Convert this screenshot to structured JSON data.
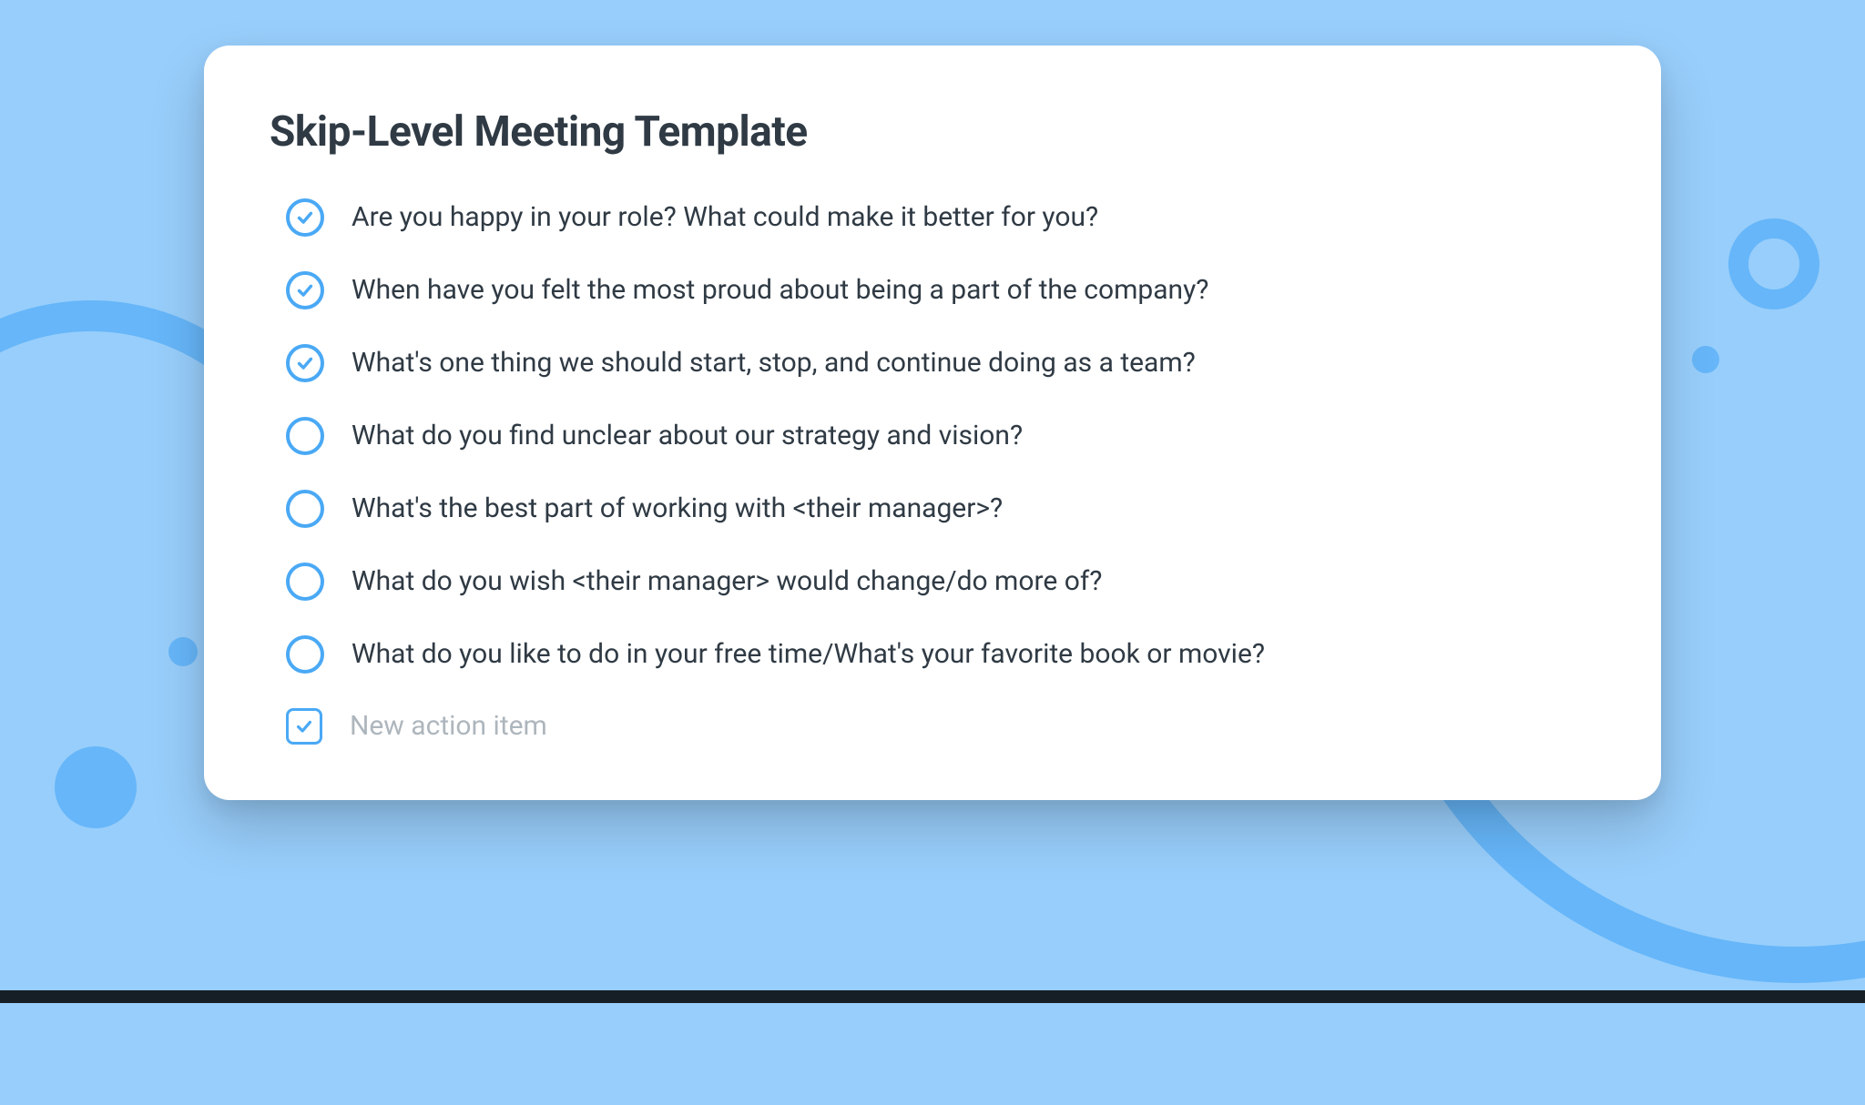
{
  "title": "Skip-Level Meeting Template",
  "items": [
    {
      "text": "Are you happy in your role? What could make it better for you?",
      "checked": true
    },
    {
      "text": "When have you felt the most proud about being a part of the company?",
      "checked": true
    },
    {
      "text": "What's one thing we should start, stop, and continue doing as a team?",
      "checked": true
    },
    {
      "text": "What do you find unclear about our strategy and vision?",
      "checked": false
    },
    {
      "text": "What's the best part of working with <their manager>?",
      "checked": false
    },
    {
      "text": "What do you wish <their manager> would change/do more of?",
      "checked": false
    },
    {
      "text": "What do you like to do in your free time/What's your favorite book or movie?",
      "checked": false
    }
  ],
  "new_item_placeholder": "New action item"
}
